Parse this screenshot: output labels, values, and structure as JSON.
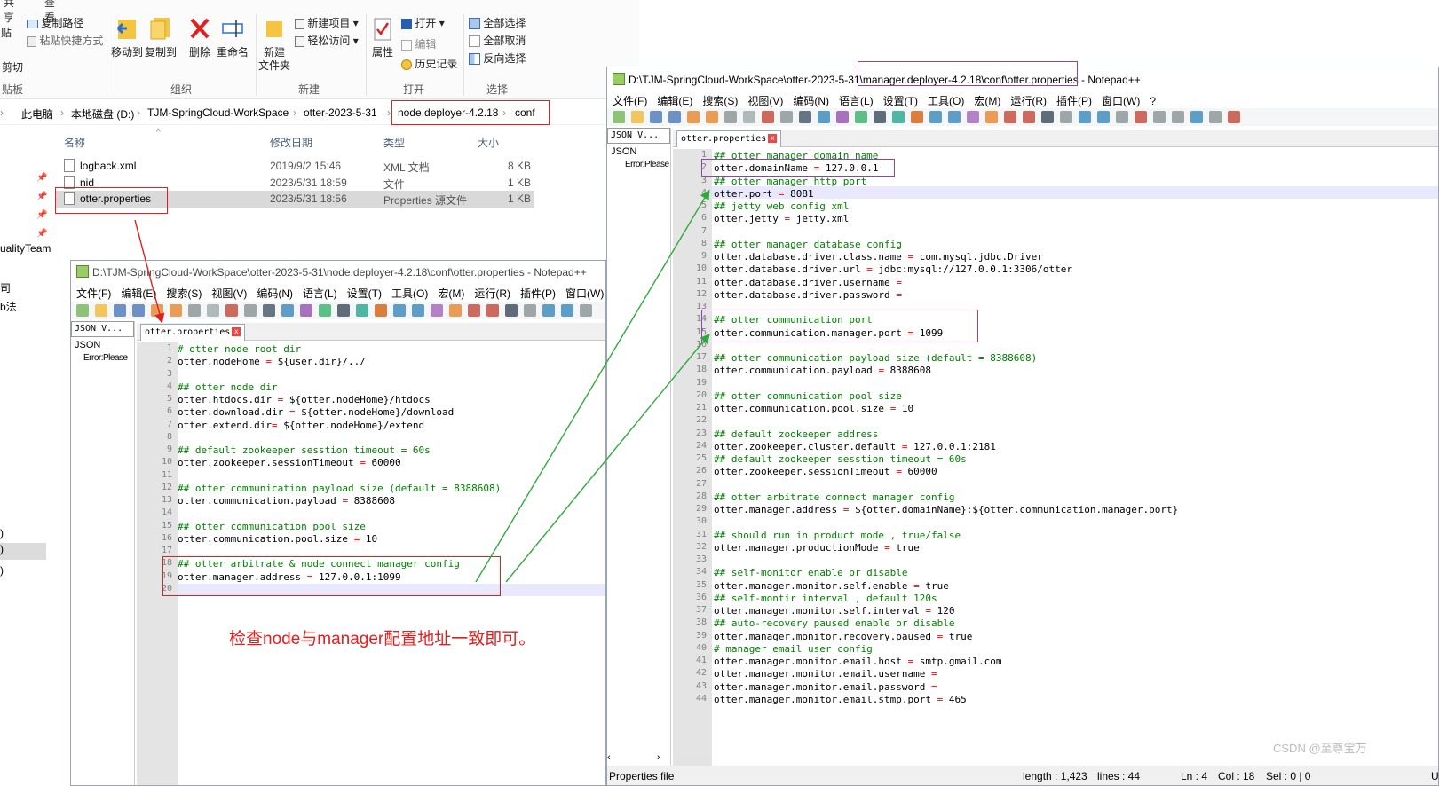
{
  "ribbon": {
    "tabs": [
      "共享",
      "查看"
    ],
    "clipboard": {
      "paste_partial": "贴",
      "cut": "剪切",
      "copy_path": "复制路径",
      "paste_shortcut": "粘贴快捷方式",
      "group_label": "贴板"
    },
    "organize": {
      "move_to": "移动到",
      "copy_to": "复制到",
      "delete": "删除",
      "rename": "重命名",
      "group_label": "组织"
    },
    "new": {
      "new_folder_line1": "新建",
      "new_folder_line2": "文件夹",
      "new_item": "新建项目",
      "easy_access": "轻松访问",
      "group_label": "新建"
    },
    "open": {
      "properties": "属性",
      "open": "打开",
      "edit": "编辑",
      "history": "历史记录",
      "group_label": "打开"
    },
    "select": {
      "select_all": "全部选择",
      "select_none": "全部取消",
      "invert": "反向选择",
      "group_label": "选择"
    }
  },
  "address": {
    "crumbs": [
      "此电脑",
      "本地磁盘 (D:)",
      "TJM-SpringCloud-WorkSpace",
      "otter-2023-5-31",
      "node.deployer-4.2.18",
      "conf"
    ]
  },
  "files": {
    "headers": {
      "name": "名称",
      "date": "修改日期",
      "type": "类型",
      "size": "大小"
    },
    "rows": [
      {
        "name": "logback.xml",
        "date": "2019/9/2 15:46",
        "type": "XML 文档",
        "size": "8 KB"
      },
      {
        "name": "nid",
        "date": "2023/5/31 18:59",
        "type": "文件",
        "size": "1 KB"
      },
      {
        "name": "otter.properties",
        "date": "2023/5/31 18:56",
        "type": "Properties 源文件",
        "size": "1 KB"
      }
    ]
  },
  "leftnav": {
    "quality_team": "ualityTeam",
    "item_a": "司",
    "item_b": "b法",
    "item_c": ")",
    "item_d": ")",
    "item_e": ")",
    "item_f": ""
  },
  "notepad_menu": [
    "文件(F)",
    "编辑(E)",
    "搜索(S)",
    "视图(V)",
    "编码(N)",
    "语言(L)",
    "设置(T)",
    "工具(O)",
    "宏(M)",
    "运行(R)",
    "插件(P)",
    "窗口(W)",
    "?"
  ],
  "node_window": {
    "title": "D:\\TJM-SpringCloud-WorkSpace\\otter-2023-5-31\\node.deployer-4.2.18\\conf\\otter.properties - Notepad++",
    "tab": "otter.properties",
    "json_header": "JSON V...",
    "json_root": "JSON",
    "json_error": "Error:Please",
    "lines": [
      "# otter node root dir",
      "otter.nodeHome = ${user.dir}/../",
      "",
      "## otter node dir",
      "otter.htdocs.dir = ${otter.nodeHome}/htdocs",
      "otter.download.dir = ${otter.nodeHome}/download",
      "otter.extend.dir= ${otter.nodeHome}/extend",
      "",
      "## default zookeeper sesstion timeout = 60s",
      "otter.zookeeper.sessionTimeout = 60000",
      "",
      "## otter communication payload size (default = 8388608)",
      "otter.communication.payload = 8388608",
      "",
      "## otter communication pool size",
      "otter.communication.pool.size = 10",
      "",
      "## otter arbitrate & node connect manager config",
      "otter.manager.address = 127.0.0.1:1099",
      ""
    ]
  },
  "manager_window": {
    "title_prefix": "D:\\TJM-SpringCloud-WorkSpace\\otter-2023-5-31\\",
    "title_highlight": "manager.deployer-4.2.18\\conf\\otter.properties",
    "title_suffix": " - Notepad++",
    "tab": "otter.properties",
    "json_header": "JSON V...",
    "json_root": "JSON",
    "json_error": "Error:Please",
    "lines": [
      "## otter manager domain name",
      "otter.domainName = 127.0.0.1",
      "## otter manager http port",
      "otter.port = 8081",
      "## jetty web config xml",
      "otter.jetty = jetty.xml",
      "",
      "## otter manager database config",
      "otter.database.driver.class.name = com.mysql.jdbc.Driver",
      "otter.database.driver.url = jdbc:mysql://127.0.0.1:3306/otter",
      "otter.database.driver.username = ",
      "otter.database.driver.password = ",
      "",
      "## otter communication port",
      "otter.communication.manager.port = 1099",
      "",
      "## otter communication payload size (default = 8388608)",
      "otter.communication.payload = 8388608",
      "",
      "## otter communication pool size",
      "otter.communication.pool.size = 10",
      "",
      "## default zookeeper address",
      "otter.zookeeper.cluster.default = 127.0.0.1:2181",
      "## default zookeeper sesstion timeout = 60s",
      "otter.zookeeper.sessionTimeout = 60000",
      "",
      "## otter arbitrate connect manager config",
      "otter.manager.address = ${otter.domainName}:${otter.communication.manager.port}",
      "",
      "## should run in product mode , true/false",
      "otter.manager.productionMode = true",
      "",
      "## self-monitor enable or disable",
      "otter.manager.monitor.self.enable = true",
      "## self-montir interval , default 120s",
      "otter.manager.monitor.self.interval = 120",
      "## auto-recovery paused enable or disable",
      "otter.manager.monitor.recovery.paused = true",
      "# manager email user config",
      "otter.manager.monitor.email.host = smtp.gmail.com",
      "otter.manager.monitor.email.username = ",
      "otter.manager.monitor.email.password = ",
      "otter.manager.monitor.email.stmp.port = 465"
    ],
    "status": {
      "file_type": "Properties file",
      "length": "length : 1,423",
      "lines": "lines : 44",
      "ln": "Ln : 4",
      "col": "Col : 18",
      "sel": "Sel : 0 | 0",
      "tail": "U"
    }
  },
  "annotation": "检查node与manager配置地址一致即可。",
  "watermark": "CSDN @至尊宝万",
  "colors": {
    "red_annotation": "#e0201f",
    "purple_box": "#8e44ad",
    "green_arrow": "#2eaa3c",
    "comment": "#008000",
    "operator": "#ff0000"
  }
}
